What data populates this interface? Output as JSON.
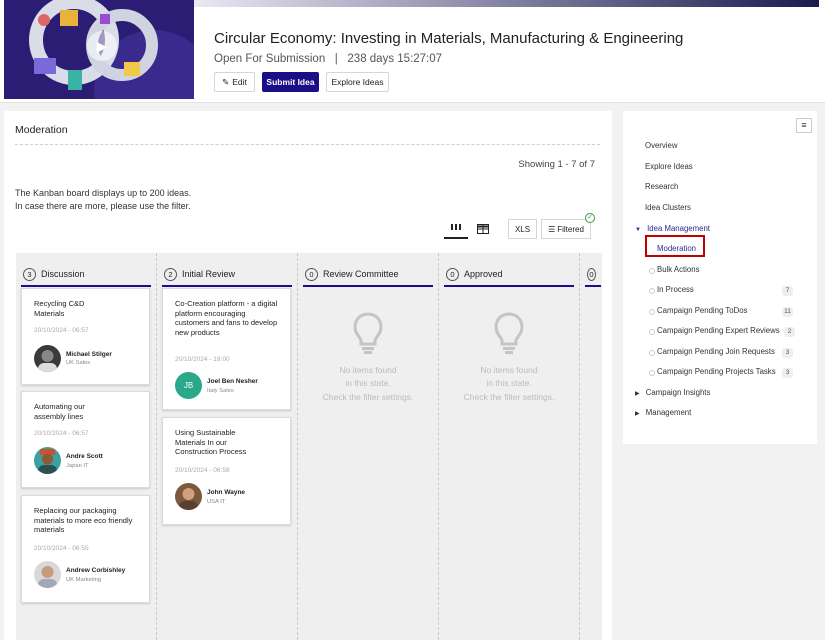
{
  "header": {
    "title": "Circular Economy: Investing in Materials, Manufacturing & Engineering",
    "status": "Open For Submission",
    "time_left": "238 days 15:27:07",
    "edit_label": "Edit",
    "submit_label": "Submit Idea",
    "explore_label": "Explore Ideas"
  },
  "main": {
    "title": "Moderation",
    "showing": "Showing 1 - 7 of 7",
    "info_line1": "The Kanban board displays up to 200 ideas.",
    "info_line2": "In case there are more, please use the filter.",
    "xls_label": "XLS",
    "filtered_label": "Filtered"
  },
  "columns": [
    {
      "count": "3",
      "name": "Discussion"
    },
    {
      "count": "2",
      "name": "Initial Review"
    },
    {
      "count": "0",
      "name": "Review Committee"
    },
    {
      "count": "0",
      "name": "Approved"
    },
    {
      "count": "0",
      "name": ""
    }
  ],
  "empty_state": {
    "line1": "No items found",
    "line2": "in this state.",
    "line3": "Check the filter settings."
  },
  "cards": {
    "discussion": [
      {
        "title": "Recycling C&D Materials",
        "date": "20/10/2024 - 06:57",
        "author": "Michael Stilger",
        "dept": "UK Sales"
      },
      {
        "title": "Automating our assembly lines",
        "date": "20/10/2024 - 06:57",
        "author": "Andre Scott",
        "dept": "Japan IT"
      },
      {
        "title": "Replacing our packaging materials to more eco friendly materials",
        "date": "20/10/2024 - 06:55",
        "author": "Andrew Corbishley",
        "dept": "UK Marketing"
      }
    ],
    "initial_review": [
      {
        "title": "Co-Creation platform - a digital platform encouraging customers and fans to develop new products",
        "date": "20/10/2024 - 19:00",
        "author": "Joel Ben Nesher",
        "dept": "Italy Sales",
        "initials": "JB"
      },
      {
        "title": "Using Sustainable Materials In our Construction Process",
        "date": "20/10/2024 - 06:58",
        "author": "John Wayne",
        "dept": "USA IT"
      }
    ]
  },
  "sidebar": {
    "overview": "Overview",
    "explore_ideas": "Explore Ideas",
    "research": "Research",
    "idea_clusters": "Idea Clusters",
    "idea_management": "Idea Management",
    "moderation": "Moderation",
    "bulk_actions": "Bulk Actions",
    "in_process": "In Process",
    "in_process_count": "7",
    "todos": "Campaign Pending ToDos",
    "todos_count": "11",
    "expert_reviews": "Campaign Pending Expert Reviews",
    "expert_reviews_count": "2",
    "join_requests": "Campaign Pending Join Requests",
    "join_requests_count": "3",
    "projects_tasks": "Campaign Pending Projects Tasks",
    "projects_tasks_count": "3",
    "campaign_insights": "Campaign Insights",
    "management": "Management"
  },
  "colors": {
    "primary": "#1a0f86",
    "active_outline": "#c00000",
    "banner": "#2b1d74"
  }
}
